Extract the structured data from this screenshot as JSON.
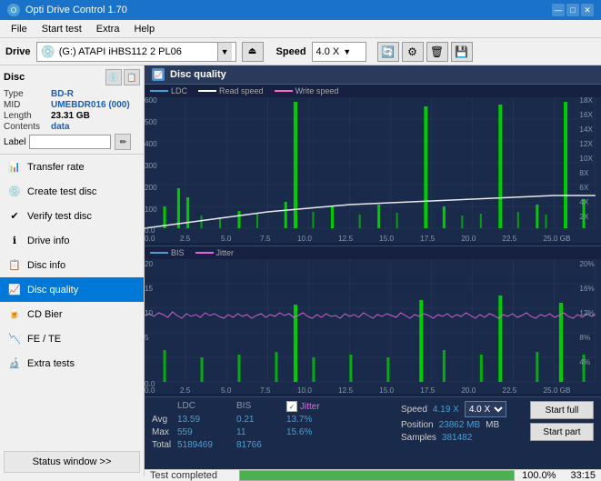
{
  "titleBar": {
    "title": "Opti Drive Control 1.70",
    "controls": [
      "—",
      "□",
      "✕"
    ]
  },
  "menuBar": {
    "items": [
      "File",
      "Start test",
      "Extra",
      "Help"
    ]
  },
  "driveBar": {
    "driveLabel": "Drive",
    "driveValue": "(G:) ATAPI iHBS112 2 PL06",
    "speedLabel": "Speed",
    "speedValue": "4.0 X"
  },
  "disc": {
    "header": "Disc",
    "typeLabel": "Type",
    "typeValue": "BD-R",
    "midLabel": "MID",
    "midValue": "UMEBDR016 (000)",
    "lengthLabel": "Length",
    "lengthValue": "23.31 GB",
    "contentsLabel": "Contents",
    "contentsValue": "data",
    "labelLabel": "Label",
    "labelValue": ""
  },
  "navigation": {
    "items": [
      {
        "id": "transfer-rate",
        "label": "Transfer rate",
        "icon": "📊"
      },
      {
        "id": "create-test-disc",
        "label": "Create test disc",
        "icon": "💿"
      },
      {
        "id": "verify-test-disc",
        "label": "Verify test disc",
        "icon": "✔"
      },
      {
        "id": "drive-info",
        "label": "Drive info",
        "icon": "ℹ"
      },
      {
        "id": "disc-info",
        "label": "Disc info",
        "icon": "📋"
      },
      {
        "id": "disc-quality",
        "label": "Disc quality",
        "icon": "📈",
        "active": true
      },
      {
        "id": "cd-bier",
        "label": "CD Bier",
        "icon": "🍺"
      },
      {
        "id": "fe-te",
        "label": "FE / TE",
        "icon": "📉"
      },
      {
        "id": "extra-tests",
        "label": "Extra tests",
        "icon": "🔬"
      }
    ],
    "statusWindowBtn": "Status window >>"
  },
  "discQuality": {
    "title": "Disc quality",
    "legend": {
      "ldc": "LDC",
      "readSpeed": "Read speed",
      "writeSpeed": "Write speed",
      "bis": "BIS",
      "jitter": "Jitter"
    },
    "topChart": {
      "yMax": 600,
      "yLabels": [
        "600",
        "500",
        "400",
        "300",
        "200",
        "100",
        "0.0"
      ],
      "yLabelsRight": [
        "18X",
        "16X",
        "14X",
        "12X",
        "10X",
        "8X",
        "6X",
        "4X",
        "2X"
      ],
      "xLabels": [
        "0.0",
        "2.5",
        "5.0",
        "7.5",
        "10.0",
        "12.5",
        "15.0",
        "17.5",
        "20.0",
        "22.5",
        "25.0 GB"
      ]
    },
    "bottomChart": {
      "yMax": 20,
      "yLabels": [
        "20",
        "15",
        "10",
        "5",
        "0.0"
      ],
      "yLabelsRight": [
        "20%",
        "16%",
        "12%",
        "8%",
        "4%"
      ],
      "xLabels": [
        "0.0",
        "2.5",
        "5.0",
        "7.5",
        "10.0",
        "12.5",
        "15.0",
        "17.5",
        "20.0",
        "22.5",
        "25.0 GB"
      ]
    },
    "stats": {
      "avgLDC": "13.59",
      "avgBIS": "0.21",
      "avgJitter": "13.7%",
      "maxLDC": "559",
      "maxBIS": "11",
      "maxJitter": "15.6%",
      "totalLDC": "5189469",
      "totalBIS": "81766",
      "speedCurrent": "4.19 X",
      "speedTarget": "4.0 X",
      "position": "23862 MB",
      "samples": "381482"
    },
    "buttons": {
      "startFull": "Start full",
      "startPart": "Start part"
    }
  },
  "statusBar": {
    "statusText": "Test completed",
    "progressPercent": 100,
    "progressLabel": "100.0%",
    "time": "33:15"
  }
}
